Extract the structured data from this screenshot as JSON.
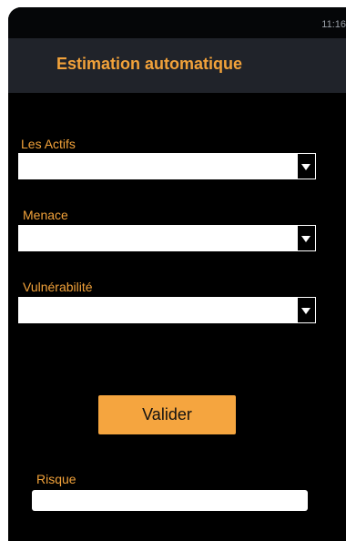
{
  "status_bar": {
    "time": "11:16"
  },
  "app_bar": {
    "title": "Estimation automatique"
  },
  "form": {
    "actifs_label": "Les Actifs",
    "actifs_value": "",
    "menace_label": "Menace",
    "menace_value": "",
    "vulnerabilite_label": "Vulnérabilité",
    "vulnerabilite_value": "",
    "submit_label": "Valider",
    "risque_label": "Risque",
    "risque_value": ""
  },
  "colors": {
    "accent": "#f2a23a",
    "button": "#f5a53f",
    "app_bar": "#20232a",
    "background": "#000000"
  },
  "icons": {
    "dropdown": "triangle-down-icon"
  }
}
